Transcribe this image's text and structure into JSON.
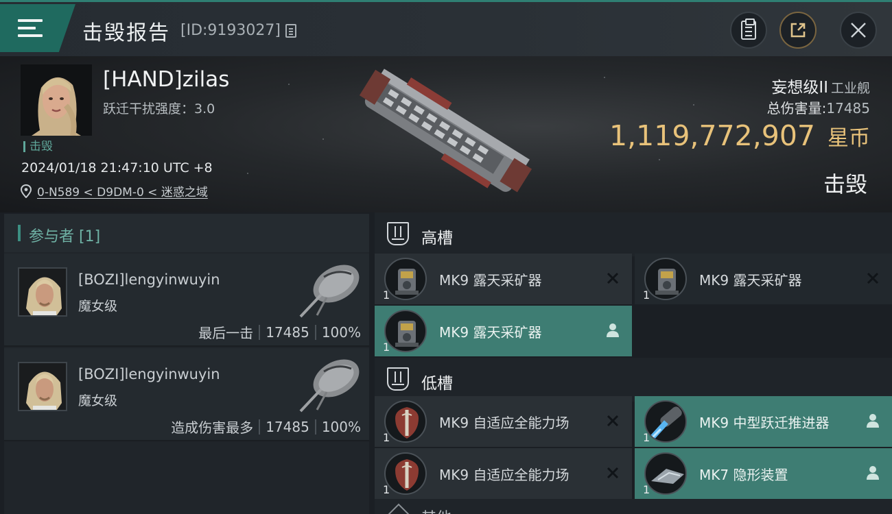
{
  "header": {
    "title": "击毁报告",
    "report_id": "[ID:9193027]"
  },
  "victim": {
    "name": "[HAND]zilas",
    "warp_label": "跃迁干扰强度：3.0",
    "kill_tag": "击毁",
    "time": "2024/01/18 21:47:10 UTC +8",
    "location": "0-N589 < D9DM-0 < 迷惑之域",
    "ship_name": "妄想级II",
    "ship_type": "工业舰",
    "damage_label": "总伤害量:",
    "damage_value": "17485",
    "isk_amount": "1,119,772,907",
    "isk_unit": "星币",
    "result": "击毁"
  },
  "participants": {
    "header": "参与者 [1]",
    "items": [
      {
        "name": "[BOZI]lengyinwuyin",
        "ship": "魔女级",
        "role": "最后一击",
        "damage": "17485",
        "percent": "100%"
      },
      {
        "name": "[BOZI]lengyinwuyin",
        "ship": "魔女级",
        "role": "造成伤害最多",
        "damage": "17485",
        "percent": "100%"
      }
    ]
  },
  "fitting": {
    "high_label": "高槽",
    "low_label": "低槽",
    "other_label": "其他",
    "high": [
      {
        "name": "MK9 露天采矿器",
        "qty": "1",
        "status": "destroyed"
      },
      {
        "name": "MK9 露天采矿器",
        "qty": "1",
        "status": "destroyed"
      },
      {
        "name": "MK9 露天采矿器",
        "qty": "1",
        "status": "dropped"
      }
    ],
    "low": [
      {
        "name": "MK9 自适应全能力场",
        "qty": "1",
        "status": "destroyed"
      },
      {
        "name": "MK9 中型跃迁推进器",
        "qty": "1",
        "status": "dropped"
      },
      {
        "name": "MK9 自适应全能力场",
        "qty": "1",
        "status": "destroyed"
      },
      {
        "name": "MK7 隐形装置",
        "qty": "1",
        "status": "dropped"
      }
    ]
  },
  "colors": {
    "accent": "#3e7d73",
    "isk": "#e8c27a",
    "label_teal": "#6fb2a5"
  }
}
